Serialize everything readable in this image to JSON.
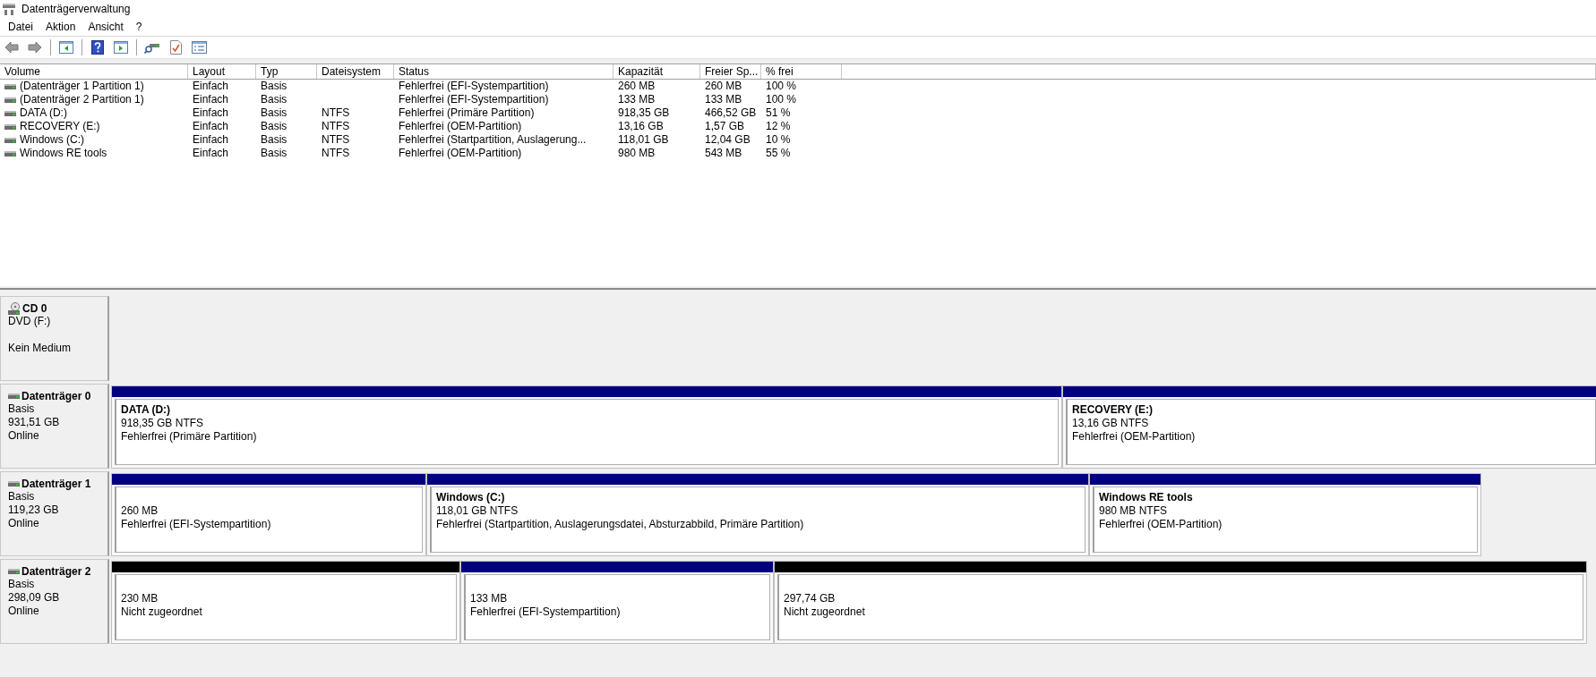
{
  "window": {
    "title": "Datenträgerverwaltung"
  },
  "menu": [
    "Datei",
    "Aktion",
    "Ansicht",
    "?"
  ],
  "table": {
    "columns": [
      "Volume",
      "Layout",
      "Typ",
      "Dateisystem",
      "Status",
      "Kapazität",
      "Freier Sp...",
      "% frei"
    ],
    "rows": [
      {
        "cells": [
          "(Datenträger 1 Partition 1)",
          "Einfach",
          "Basis",
          null,
          "Fehlerfrei (EFI-Systempartition)",
          "260 MB",
          "260 MB",
          "100 %"
        ]
      },
      {
        "cells": [
          "(Datenträger 2 Partition 1)",
          "Einfach",
          "Basis",
          null,
          "Fehlerfrei (EFI-Systempartition)",
          "133 MB",
          "133 MB",
          "100 %"
        ]
      },
      {
        "cells": [
          "DATA (D:)",
          "Einfach",
          "Basis",
          "NTFS",
          "Fehlerfrei (Primäre Partition)",
          "918,35 GB",
          "466,52 GB",
          "51 %"
        ]
      },
      {
        "cells": [
          "RECOVERY (E:)",
          "Einfach",
          "Basis",
          "NTFS",
          "Fehlerfrei (OEM-Partition)",
          "13,16 GB",
          "1,57 GB",
          "12 %"
        ]
      },
      {
        "cells": [
          "Windows (C:)",
          "Einfach",
          "Basis",
          "NTFS",
          "Fehlerfrei (Startpartition, Auslagerung...",
          "118,01 GB",
          "12,04 GB",
          "10 %"
        ]
      },
      {
        "cells": [
          "Windows RE tools",
          "Einfach",
          "Basis",
          "NTFS",
          "Fehlerfrei (OEM-Partition)",
          "980 MB",
          "543 MB",
          "55 %"
        ]
      }
    ]
  },
  "disks": [
    {
      "kind": "cd",
      "name": "CD 0",
      "lines": [
        "DVD (F:)"
      ],
      "note": "Kein Medium"
    },
    {
      "kind": "disk",
      "name": "Datenträger 0",
      "lines": [
        "Basis",
        "931,51 GB",
        "Online"
      ],
      "partitions": [
        {
          "kind": "primary",
          "name": "DATA  (D:)",
          "size": "918,35 GB NTFS",
          "status": "Fehlerfrei (Primäre Partition)"
        },
        {
          "kind": "primary",
          "name": "RECOVERY  (E:)",
          "size": "13,16 GB NTFS",
          "status": "Fehlerfrei (OEM-Partition)"
        }
      ]
    },
    {
      "kind": "disk",
      "name": "Datenträger 1",
      "lines": [
        "Basis",
        "119,23 GB",
        "Online"
      ],
      "partitions": [
        {
          "kind": "primary",
          "size": "260 MB",
          "status": "Fehlerfrei (EFI-Systempartition)"
        },
        {
          "kind": "primary",
          "name": "Windows  (C:)",
          "size": "118,01 GB NTFS",
          "status": "Fehlerfrei (Startpartition, Auslagerungsdatei, Absturzabbild, Primäre Partition)"
        },
        {
          "kind": "primary",
          "name": "Windows RE tools",
          "size": "980 MB NTFS",
          "status": "Fehlerfrei (OEM-Partition)"
        }
      ]
    },
    {
      "kind": "disk",
      "name": "Datenträger 2",
      "lines": [
        "Basis",
        "298,09 GB",
        "Online"
      ],
      "partitions": [
        {
          "kind": "unallocated",
          "size": "230 MB",
          "status": "Nicht zugeordnet"
        },
        {
          "kind": "primary",
          "size": "133 MB",
          "status": "Fehlerfrei (EFI-Systempartition)"
        },
        {
          "kind": "unallocated",
          "size": "297,74 GB",
          "status": "Nicht zugeordnet"
        }
      ]
    }
  ]
}
